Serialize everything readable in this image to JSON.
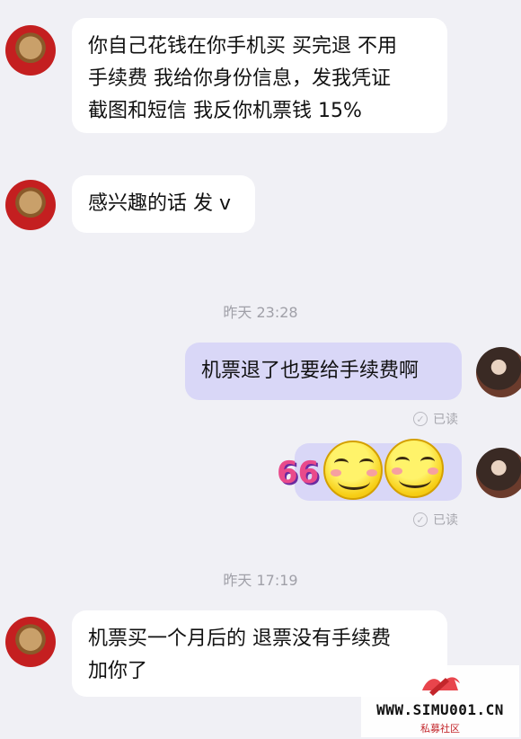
{
  "colors": {
    "background": "#f0f0f5",
    "incoming_bubble": "#ffffff",
    "outgoing_bubble": "#d9d7f7",
    "timestamp_text": "#a0a0a8"
  },
  "messages": [
    {
      "sender": "other",
      "avatar_icon": "lion-knocker-avatar",
      "lines": [
        "你自己花钱在你手机买 买完退 不用",
        "手续费 我给你身份信息，发我凭证",
        "截图和短信 我反你机票钱 15%"
      ]
    },
    {
      "sender": "other",
      "avatar_icon": "lion-knocker-avatar",
      "lines": [
        "感兴趣的话 发 v"
      ]
    },
    {
      "timestamp": "昨天 23:28"
    },
    {
      "sender": "me",
      "avatar_icon": "woman-portrait-avatar",
      "lines": [
        "机票退了也要给手续费啊"
      ],
      "status": "已读"
    },
    {
      "sender": "me",
      "avatar_icon": "woman-portrait-avatar",
      "sticker": "66",
      "status": "已读"
    },
    {
      "timestamp": "昨天 17:19"
    },
    {
      "sender": "other",
      "avatar_icon": "lion-knocker-avatar",
      "lines": [
        "机票买一个月后的 退票没有手续费",
        "加你了"
      ]
    }
  ],
  "watermark": {
    "text": "WWW.SIMU001.CN",
    "subtitle": "私募社区"
  }
}
